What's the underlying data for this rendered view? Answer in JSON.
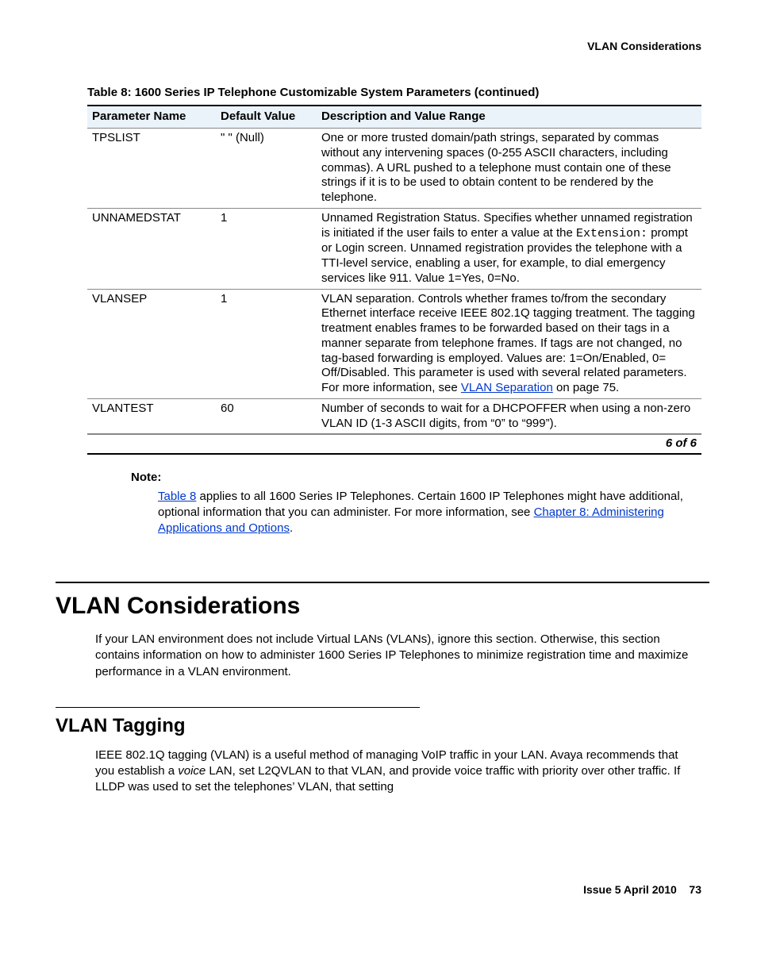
{
  "header": {
    "right": "VLAN Considerations"
  },
  "table": {
    "caption": "Table 8: 1600 Series IP Telephone Customizable System Parameters  (continued)",
    "headers": {
      "param": "Parameter Name",
      "default": "Default Value",
      "desc": "Description and Value Range"
    },
    "rows": [
      {
        "param": "TPSLIST",
        "default": "\" \" (Null)",
        "desc_plain": "One or more trusted domain/path strings, separated by commas without any intervening spaces (0-255 ASCII characters, including commas). A URL pushed to a telephone must contain one of these strings if it is to be used to obtain content to be rendered by the telephone."
      },
      {
        "param": "UNNAMEDSTAT",
        "default": "1",
        "desc_pre": "Unnamed Registration Status. Specifies whether unnamed registration is initiated if the user fails to enter a value at the ",
        "desc_code": "Extension:",
        "desc_post": " prompt or Login screen. Unnamed registration provides the telephone with a TTI-level service, enabling a user, for example, to dial emergency services like 911. Value 1=Yes, 0=No."
      },
      {
        "param": "VLANSEP",
        "default": "1",
        "desc_pre": "VLAN separation. Controls whether frames to/from the secondary Ethernet interface receive IEEE 802.1Q tagging treatment. The tagging treatment enables frames to be forwarded based on their tags in a manner separate from telephone frames. If tags are not changed, no tag-based forwarding is employed. Values are: 1=On/Enabled, 0= Off/Disabled. This parameter is used with several related parameters. For more information, see ",
        "desc_link": "VLAN Separation",
        "desc_post": " on page 75."
      },
      {
        "param": "VLANTEST",
        "default": "60",
        "desc_plain": "Number of seconds to wait for a DHCPOFFER when using a non-zero VLAN ID (1-3 ASCII digits, from “0” to “999”)."
      }
    ],
    "foot": "6 of 6"
  },
  "note": {
    "label": "Note:",
    "link1": "Table 8",
    "text1": " applies to all 1600 Series IP Telephones. Certain 1600 IP Telephones might have additional, optional information that you can administer. For more information, see ",
    "link2": "Chapter 8: Administering Applications and Options",
    "period": "."
  },
  "section": {
    "title": "VLAN Considerations",
    "para": "If your LAN environment does not include Virtual LANs (VLANs), ignore this section. Otherwise, this section contains information on how to administer 1600 Series IP Telephones to minimize registration time and maximize performance in a VLAN environment."
  },
  "subsection": {
    "title": "VLAN Tagging",
    "para_pre": "IEEE 802.1Q tagging (VLAN) is a useful method of managing VoIP traffic in your LAN. Avaya recommends that you establish a ",
    "para_em": "voice",
    "para_post": " LAN, set L2QVLAN to that VLAN, and provide voice traffic with priority over other traffic. If LLDP was used to set the telephones’ VLAN, that setting"
  },
  "footer": {
    "issue": "Issue 5   April 2010",
    "page": "73"
  }
}
